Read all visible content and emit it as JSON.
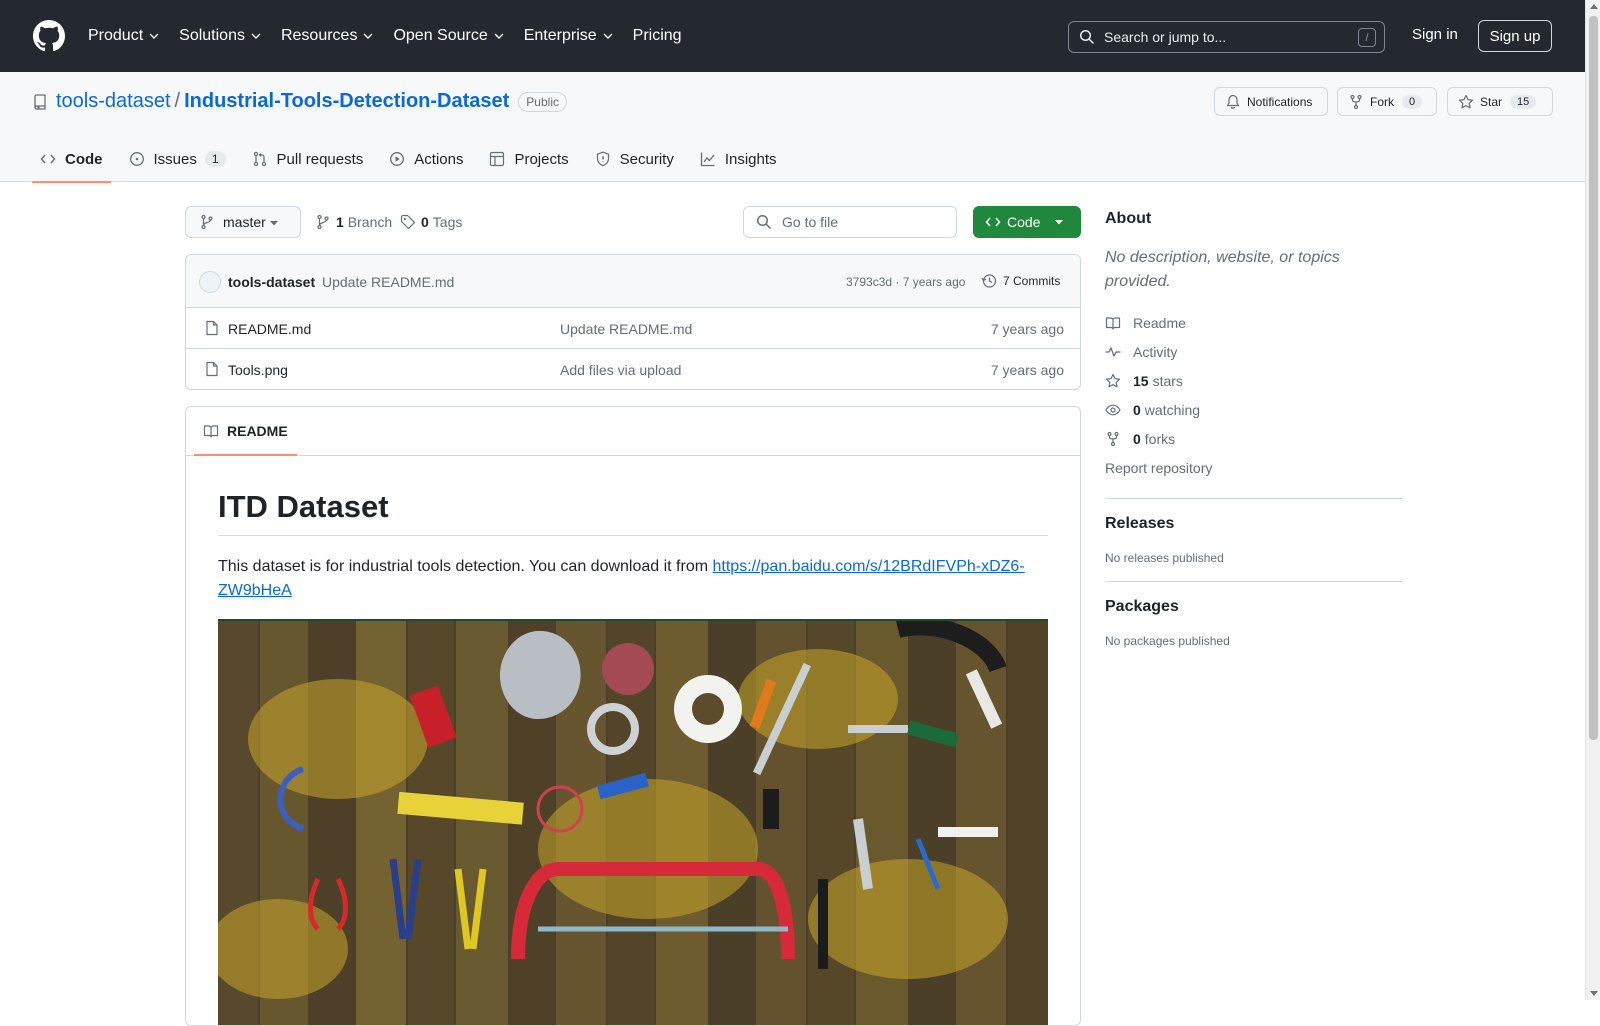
{
  "header": {
    "nav": [
      "Product",
      "Solutions",
      "Resources",
      "Open Source",
      "Enterprise",
      "Pricing"
    ],
    "search_placeholder": "Search or jump to...",
    "search_shortcut": "/",
    "sign_in": "Sign in",
    "sign_up": "Sign up"
  },
  "repo": {
    "owner": "tools-dataset",
    "separator": "/",
    "name": "Industrial-Tools-Detection-Dataset",
    "visibility": "Public",
    "notifications": "Notifications",
    "fork_label": "Fork",
    "fork_count": "0",
    "star_label": "Star",
    "star_count": "15"
  },
  "tabs": {
    "code": "Code",
    "issues": "Issues",
    "issues_count": "1",
    "pulls": "Pull requests",
    "actions": "Actions",
    "projects": "Projects",
    "security": "Security",
    "insights": "Insights"
  },
  "toolbar": {
    "branch": "master",
    "branch_count": "1",
    "branch_label": "Branch",
    "tag_count": "0",
    "tag_label": "Tags",
    "goto_file": "Go to file",
    "code_button": "Code"
  },
  "commit": {
    "author": "tools-dataset",
    "message": "Update README.md",
    "hash_time": "3793c3d · 7 years ago",
    "commits": "7 Commits"
  },
  "files": [
    {
      "name": "README.md",
      "message": "Update README.md",
      "time": "7 years ago"
    },
    {
      "name": "Tools.png",
      "message": "Add files via upload",
      "time": "7 years ago"
    }
  ],
  "readme": {
    "tab": "README",
    "title": "ITD Dataset",
    "text": "This dataset is for industrial tools detection. You can download it from ",
    "link": "https://pan.baidu.com/s/12BRdIFVPh-xDZ6-ZW9bHeA"
  },
  "sidebar": {
    "about_title": "About",
    "about_desc": "No description, website, or topics provided.",
    "readme": "Readme",
    "activity": "Activity",
    "stars_count": "15",
    "stars_label": "stars",
    "watching_count": "0",
    "watching_label": "watching",
    "forks_count": "0",
    "forks_label": "forks",
    "report": "Report repository",
    "releases_title": "Releases",
    "releases_text": "No releases published",
    "packages_title": "Packages",
    "packages_text": "No packages published"
  },
  "colors": {
    "header_bg": "#24292f",
    "link": "#0969da",
    "code_button": "#1f883d",
    "tab_underline": "#fd8c73"
  },
  "icons": [
    "github-logo-icon",
    "search-icon",
    "repo-icon",
    "bell-icon",
    "fork-icon",
    "star-icon",
    "code-icon",
    "issue-icon",
    "pull-request-icon",
    "play-icon",
    "table-icon",
    "shield-icon",
    "graph-icon",
    "branch-icon",
    "tag-icon",
    "history-icon",
    "file-icon",
    "book-icon",
    "pulse-icon",
    "eye-icon"
  ]
}
